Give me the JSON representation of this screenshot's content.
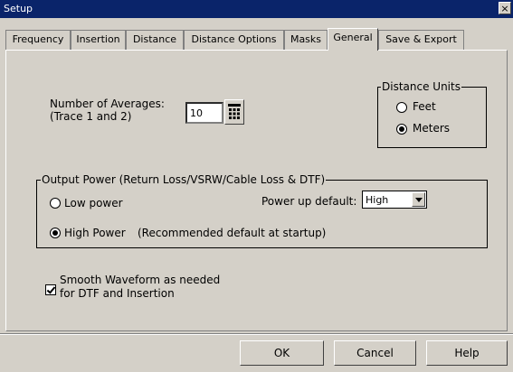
{
  "window": {
    "title": "Setup",
    "close_glyph": "×"
  },
  "tabs": [
    {
      "label": "Frequency"
    },
    {
      "label": "Insertion"
    },
    {
      "label": "Distance"
    },
    {
      "label": "Distance Options"
    },
    {
      "label": "Masks"
    },
    {
      "label": "General",
      "active": true
    },
    {
      "label": "Save & Export"
    }
  ],
  "averages": {
    "label_line1": "Number of Averages:",
    "label_line2": "(Trace 1 and 2)",
    "value": "10",
    "keypad_icon": "keypad-icon"
  },
  "distance_units": {
    "title": "Distance Units",
    "options": [
      {
        "label": "Feet",
        "checked": false
      },
      {
        "label": "Meters",
        "checked": true
      }
    ]
  },
  "output_power": {
    "title": "Output Power (Return Loss/VSRW/Cable Loss & DTF)",
    "low_label": "Low power",
    "high_label": "High Power",
    "high_note": "(Recommended default at startup)",
    "selected": "High Power",
    "power_up_label": "Power up default:",
    "power_up_value": "High"
  },
  "smooth": {
    "line1": "Smooth Waveform as needed",
    "line2": "for DTF and Insertion",
    "checked": true
  },
  "buttons": {
    "ok": "OK",
    "cancel": "Cancel",
    "help": "Help"
  },
  "colors": {
    "face": "#d4d0c8",
    "titlebar": "#0a246a"
  }
}
